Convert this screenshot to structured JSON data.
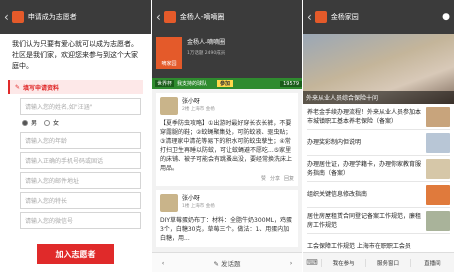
{
  "panel1": {
    "title": "申请成为志愿者",
    "intro": "我们认为只要有爱心就可以成为志愿者。社区是我们家，欢迎您来参与到这个大家庭中。",
    "form_heading": "填写申请资料",
    "fields": [
      {
        "placeholder": "请输入您的姓名,如\"汪涵\""
      },
      {
        "placeholder": "请输入您的年龄"
      },
      {
        "placeholder": "请输入正确的手机号码或固话"
      },
      {
        "placeholder": "请输入您的邮件地址"
      },
      {
        "placeholder": "请输入您的特长"
      },
      {
        "placeholder": "请输入您的微信号"
      }
    ],
    "gender_male": "男",
    "gender_female": "女",
    "submit": "加入志愿者"
  },
  "panel2": {
    "title": "金杨人-嘀嘀圈",
    "logo_text": "嘀家园",
    "name": "金杨人-嘀嘀圈",
    "stats": "1万话题    2490成员",
    "banner_tag": "世界杯",
    "banner_text": "我支持的球队",
    "banner_join": "参加",
    "banner_count": "19579",
    "posts": [
      {
        "author": "张小呀",
        "meta": "2楼    上海市 金杨",
        "body": "【夏季防虫攻略】①出游时最好穿长衣长裤，不要穿露腿的鞋；②蚊蝇聚集处，可防蚊液、驱虫贴；③清理家中清花等易下的积水可防蚊虫孳生；④常打扫卫生再睡以防蚊，可让蚊蝇避不愿吃...⑤家里的床铺、被子可能会有跳蚤出没，要经常换洗床上用品。",
        "like": "赞",
        "share": "分享",
        "reply": "回复"
      },
      {
        "author": "张小呀",
        "meta": "1楼    上海市 金杨",
        "body": "DIY草莓蛋奶布丁：材料：全脂牛奶300ML，鸡蛋3个，白糖30克，草莓三个。做法：1、用蛋内加白糖，用..."
      }
    ],
    "reply_placeholder": "发话题"
  },
  "panel3": {
    "title": "金杨家园",
    "hero_caption": "外来从业人员综合保险十问",
    "news": [
      "养老金手续办理流程！外来从业人员参加本市城镇职工基本养老保险（备案）",
      "办理奖彩制内但说明",
      "办理居住证，办理学籍卡，办理你家教育服务指南（备案）",
      "组织关键信息修改指南",
      "居住房屋租赁合同登记备案工作规范，廉租房工作规范",
      "工会保障工作规范 上海市在职职工会员"
    ],
    "menu": [
      "我在参与",
      "服务窗口",
      "直播间"
    ]
  }
}
